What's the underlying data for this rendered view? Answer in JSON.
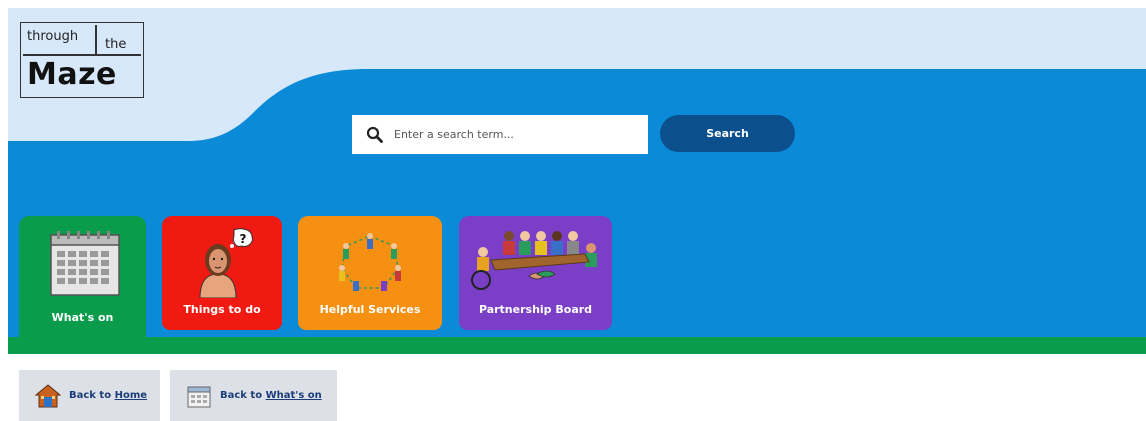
{
  "logo": {
    "word_through": "through",
    "word_the": "the",
    "word_maze": "Maze"
  },
  "search": {
    "placeholder": "Enter a search term...",
    "button_label": "Search"
  },
  "nav_tiles": [
    {
      "label": "What's on",
      "icon": "calendar-icon",
      "color": "#0a9c4a"
    },
    {
      "label": "Things to do",
      "icon": "thinking-person-icon",
      "color": "#f01a12"
    },
    {
      "label": "Helpful Services",
      "icon": "people-circle-icon",
      "color": "#f59013"
    },
    {
      "label": "Partnership Board",
      "icon": "meeting-table-icon",
      "color": "#7a3fc6"
    }
  ],
  "back_links": [
    {
      "prefix": "Back to",
      "link": "Home",
      "icon": "house-icon"
    },
    {
      "prefix": "Back to",
      "link": "What's on",
      "icon": "calendar-page-icon"
    }
  ],
  "colors": {
    "header_blue": "#0b8ad8",
    "wave_light": "#d7e8fa",
    "accent_green": "#0a9c4a",
    "search_button": "#0c4f8d"
  }
}
